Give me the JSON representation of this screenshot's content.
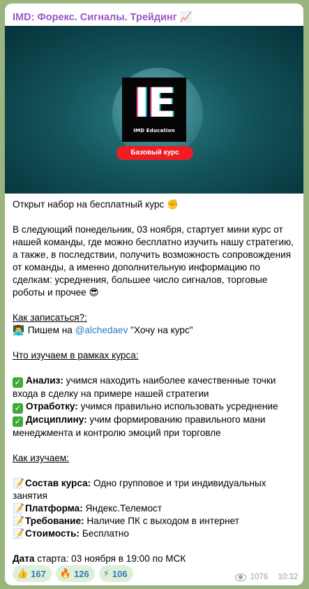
{
  "channel": {
    "title": "IMD: Форекс. Сигналы. Трейдинг",
    "title_emoji": "📈"
  },
  "media": {
    "logo_letters": "IE",
    "logo_sub": "IMD Education",
    "badge": "Базовый курс"
  },
  "post": {
    "intro": "Открыт набор на бесплатный курс",
    "intro_emoji": "✊",
    "para": "В следующий понедельник, 03 ноября, стартует мини курс от нашей команды, где можно бесплатно изучить нашу стратегию, а также, в последствии, получить возможность сопровождения от команды, а именно дополнительную информацию по сделкам: усреднения, большее число сигналов, торговые роботы и прочее",
    "para_emoji": "😎",
    "signup_heading": "Как записаться?:",
    "signup_prefix": "Пишем на",
    "signup_link": "@alchedaev",
    "signup_suffix": "\"Хочу на курс\"",
    "learn_heading": "Что изучаем в рамках курса:",
    "learn_items": [
      {
        "bold": "Анализ:",
        "text": "учимся находить наиболее качественные точки входа в сделку на примере нашей стратегии"
      },
      {
        "bold": "Отработку:",
        "text": "учимся правильно использовать усреднение"
      },
      {
        "bold": "Дисциплину:",
        "text": "учим формированию правильного мани менеджмента и контролю эмоций при торговле"
      }
    ],
    "how_heading": "Как изучаем:",
    "how_items": [
      {
        "bold": "Состав курса:",
        "text": "Одно групповое и три индивидуальных занятия"
      },
      {
        "bold": "Платформа:",
        "text": "Яндекс.Телемост"
      },
      {
        "bold": "Требование:",
        "text": "Наличие ПК с выходом в интернет"
      },
      {
        "bold": "Стоимость:",
        "text": "Бесплатно"
      }
    ],
    "start_bold": "Дата",
    "start_text": "старта: 03 ноября в 19:00 по МСК"
  },
  "reactions": [
    {
      "icon": "👍",
      "count": "167"
    },
    {
      "icon": "🔥",
      "count": "126"
    },
    {
      "icon": "⚡",
      "count": "106"
    }
  ],
  "meta": {
    "views": "1076",
    "time": "10:32"
  }
}
